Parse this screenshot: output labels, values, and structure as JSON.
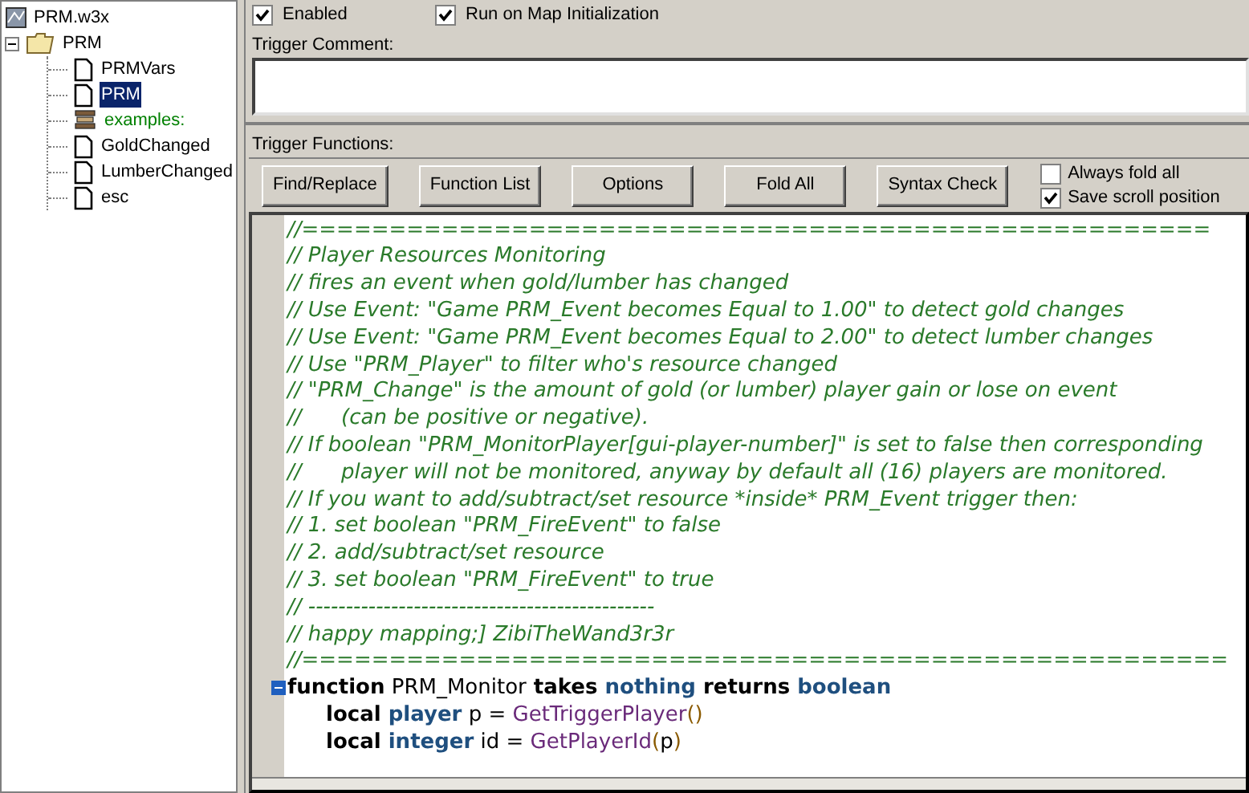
{
  "tree": {
    "label": "PRM.w3x",
    "children": [
      {
        "label": "PRM",
        "kind": "folder",
        "expanded": true,
        "selected": false,
        "children": [
          {
            "label": "PRMVars",
            "kind": "trigger",
            "selected": false
          },
          {
            "label": "PRM",
            "kind": "trigger",
            "selected": true
          },
          {
            "label": "examples:",
            "kind": "comment",
            "selected": false
          },
          {
            "label": "GoldChanged",
            "kind": "trigger",
            "selected": false
          },
          {
            "label": "LumberChanged",
            "kind": "trigger",
            "selected": false
          },
          {
            "label": "esc",
            "kind": "trigger",
            "selected": false
          }
        ]
      }
    ]
  },
  "options": [
    {
      "label": "Enabled",
      "checked": true
    },
    {
      "label": "Run on Map Initialization",
      "checked": true
    }
  ],
  "comment": {
    "label": "Trigger Comment:"
  },
  "functions": {
    "label": "Trigger Functions:",
    "buttons": [
      "Find/Replace",
      "Function List",
      "Options",
      "Fold All",
      "Syntax Check"
    ],
    "settings": [
      {
        "label": "Always fold all",
        "checked": false
      },
      {
        "label": "Save scroll position",
        "checked": true
      }
    ]
  },
  "code": [
    {
      "kind": "comment",
      "text": "//===================================================="
    },
    {
      "kind": "comment",
      "text": "// Player Resources Monitoring"
    },
    {
      "kind": "comment",
      "text": "// fires an event when gold/lumber has changed"
    },
    {
      "kind": "comment",
      "text": "// Use Event: \"Game PRM_Event becomes Equal to 1.00\" to detect gold changes"
    },
    {
      "kind": "comment",
      "text": "// Use Event: \"Game PRM_Event becomes Equal to 2.00\" to detect lumber changes"
    },
    {
      "kind": "comment",
      "text": "// Use \"PRM_Player\" to filter who's resource changed"
    },
    {
      "kind": "comment",
      "text": "// \"PRM_Change\" is the amount of gold (or lumber) player gain or lose on event"
    },
    {
      "kind": "comment",
      "text": "//      (can be positive or negative)."
    },
    {
      "kind": "comment",
      "text": "// If boolean \"PRM_MonitorPlayer[gui-player-number]\" is set to false then corresponding"
    },
    {
      "kind": "comment",
      "text": "//      player will not be monitored, anyway by default all (16) players are monitored."
    },
    {
      "kind": "comment",
      "text": "// If you want to add/subtract/set resource *inside* PRM_Event trigger then:"
    },
    {
      "kind": "comment",
      "text": "// 1. set boolean \"PRM_FireEvent\" to false"
    },
    {
      "kind": "comment",
      "text": "// 2. add/subtract/set resource"
    },
    {
      "kind": "comment",
      "text": "// 3. set boolean \"PRM_FireEvent\" to true"
    },
    {
      "kind": "comment",
      "text": "// ----------------------------------------------"
    },
    {
      "kind": "comment",
      "text": "// happy mapping;] ZibiTheWand3r3r"
    },
    {
      "kind": "comment",
      "text": "//====================================================="
    },
    {
      "kind": "code",
      "fold": true,
      "indented": false,
      "tokens": [
        {
          "kind": "keyword",
          "text": "function"
        },
        {
          "kind": "plain",
          "text": "PRM_Monitor"
        },
        {
          "kind": "keyword",
          "text": "takes"
        },
        {
          "kind": "type",
          "text": "nothing"
        },
        {
          "kind": "keyword",
          "text": "returns"
        },
        {
          "kind": "type",
          "text": "boolean"
        }
      ]
    },
    {
      "kind": "code",
      "fold": false,
      "indented": true,
      "tokens": [
        {
          "kind": "keyword",
          "text": "local"
        },
        {
          "kind": "type",
          "text": "player"
        },
        {
          "kind": "plain",
          "text": "p ="
        },
        {
          "kind": "native",
          "text": "GetTriggerPlayer"
        },
        {
          "kind": "paren",
          "text": "()"
        }
      ]
    },
    {
      "kind": "code",
      "fold": false,
      "indented": true,
      "tokens": [
        {
          "kind": "keyword",
          "text": "local"
        },
        {
          "kind": "type",
          "text": "integer"
        },
        {
          "kind": "plain",
          "text": "id ="
        },
        {
          "kind": "native",
          "text": "GetPlayerId"
        },
        {
          "kind": "paren",
          "text": "("
        },
        {
          "kind": "plain",
          "text": "p"
        },
        {
          "kind": "paren",
          "text": ")"
        }
      ]
    }
  ]
}
